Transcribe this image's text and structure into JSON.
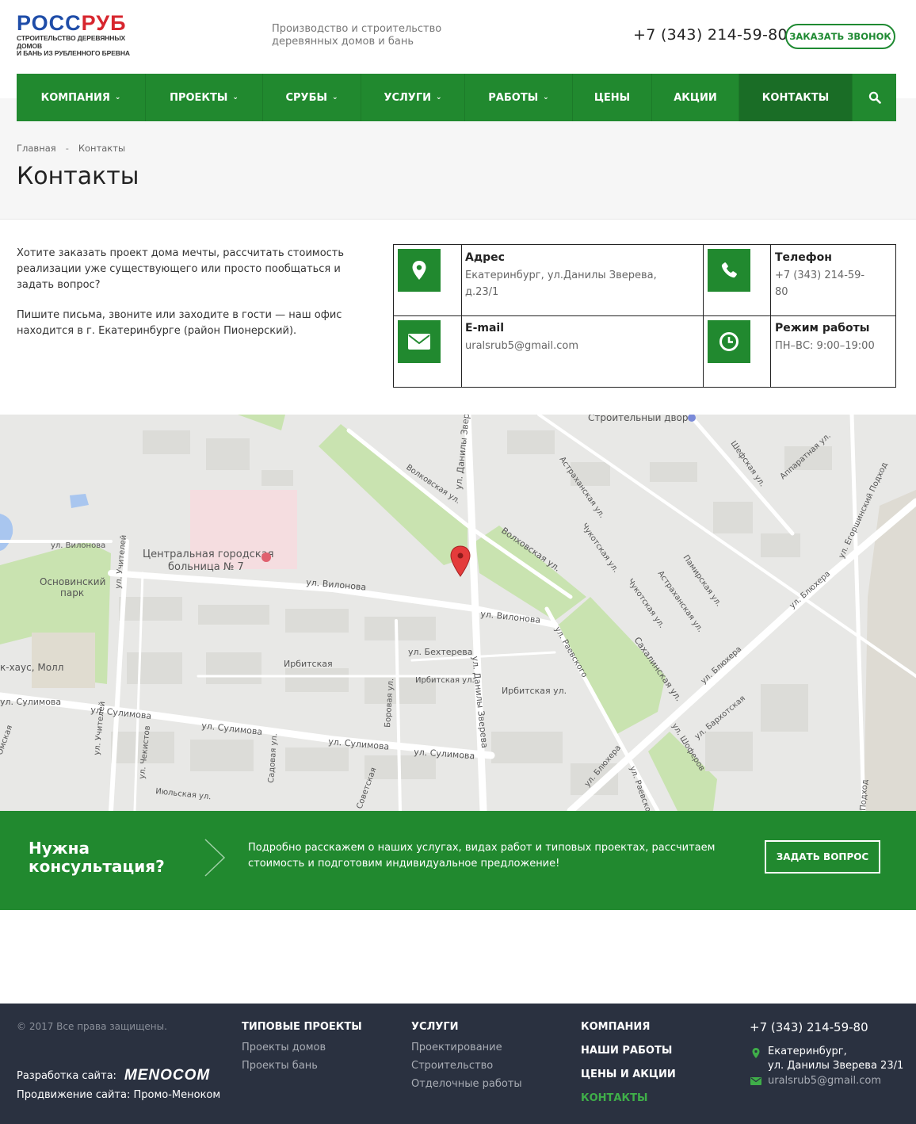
{
  "header": {
    "logo_title": "РОССРУБ",
    "logo_line1": "СТРОИТЕЛЬСТВО ДЕРЕВЯННЫХ ДОМОВ",
    "logo_line2": "И БАНЬ ИЗ РУБЛЕННОГО БРЕВНА",
    "tagline_1": "Производство и строительство",
    "tagline_2": "деревянных домов и бань",
    "phone": "+7 (343) 214-59-80",
    "callback_label": "ЗАКАЗАТЬ ЗВОНОК"
  },
  "nav": {
    "items": [
      {
        "label": "КОМПАНИЯ",
        "dropdown": true
      },
      {
        "label": "ПРОЕКТЫ",
        "dropdown": true
      },
      {
        "label": "СРУБЫ",
        "dropdown": true
      },
      {
        "label": "УСЛУГИ",
        "dropdown": true
      },
      {
        "label": "РАБОТЫ",
        "dropdown": true
      },
      {
        "label": "ЦЕНЫ",
        "dropdown": false
      },
      {
        "label": "АКЦИИ",
        "dropdown": false
      },
      {
        "label": "КОНТАКТЫ",
        "dropdown": false,
        "active": true
      }
    ],
    "search_icon": "search-icon"
  },
  "breadcrumb": {
    "home": "Главная",
    "separator": "-",
    "current": "Контакты"
  },
  "page_title": "Контакты",
  "intro": {
    "p1": "Хотите заказать проект дома мечты, рассчитать стоимость реализации уже существующего или просто пообщаться и задать вопрос?",
    "p2": "Пишите письма, звоните или заходите в гости — наш офис находится в г. Екатеринбурге (район Пионерский)."
  },
  "contacts": {
    "address": {
      "label": "Адрес",
      "value_1": "Екатеринбург, ул.Данилы Зверева,",
      "value_2": "д.23/1",
      "icon": "map-marker-icon"
    },
    "phone": {
      "label": "Телефон",
      "value_1": "+7 (343) 214-59-",
      "value_2": "80",
      "icon": "phone-icon"
    },
    "email": {
      "label": "E-mail",
      "value": "uralsrub5@gmail.com",
      "icon": "envelope-icon"
    },
    "hours": {
      "label": "Режим работы",
      "value": "ПН–ВС: 9:00–19:00",
      "icon": "clock-icon"
    }
  },
  "map": {
    "labels": {
      "builder_yard": "Строительный двор",
      "hospital_1": "Центральная городская",
      "hospital_2": "больница № 7",
      "park_1": "Основинский",
      "park_2": "парк",
      "mall": "к-хаус, Молл",
      "vilonova_1": "ул. Вилонова",
      "vilonova_2": "ул. Вилонова",
      "vilonova_3": "ул. Вилонова",
      "sulimova_1": "ул. Сулимова",
      "sulimova_2": "ул. Сулимова",
      "sulimova_3": "ул. Сулимова",
      "sulimova_4": "ул. Сулимова",
      "sulimova_5": "ул. Сулимова",
      "bekhtereva": "ул. Бехтерева",
      "irbitskaya_1": "Ирбитская",
      "irbitskaya_2": "Ирбитская ул.",
      "irbitskaya_3": "Ирбитская ул.",
      "zvereva_1": "ул. Данилы Зверева",
      "zvereva_2": "ул. Данилы Зверева",
      "volkovskaya": "Волковская ул.",
      "volkhovskaya": "Волховская ул.",
      "astrakhanskaya_1": "Астраханская ул.",
      "astrakhanskaya_2": "Астраханская ул.",
      "chukotskaya_1": "Чукотская ул.",
      "chukotskaya_2": "Чукотская ул.",
      "pamirskaya": "Памирская ул.",
      "sakhalinskaya": "Сахалинская ул.",
      "raevskogo_1": "ул. Раевского",
      "raevskogo_2": "ул. Раевского",
      "blyukhera_1": "ул. Блюхера",
      "blyukhera_2": "ул. Блюхера",
      "blyukhera_3": "ул. Блюхера",
      "shoferov_1": "Шефская ул.",
      "shoferov_2": "ул. Шоферов",
      "barkhotskaya": "ул. Бархотская",
      "egorshinsky": "ул. Егоршинский Подход",
      "apparatnaya": "Аппаратная ул.",
      "uchiteley_1": "ул. Учителей",
      "uchiteley_2": "ул. Учителей",
      "chekistov": "ул. Чекистов",
      "borovaya": "Боровая ул.",
      "sadovaya": "Садовая ул.",
      "iyulskaya": "Июльская ул.",
      "sovetskaya": "Советская",
      "omskaya": "Омская",
      "podkhod": "Подход",
      "vilonova_top": "ул. Вилонова"
    }
  },
  "cta": {
    "title_1": "Нужна",
    "title_2": "консультация?",
    "text": "Подробно расскажем о наших услугах, видах работ и типовых проектах, рассчитаем стоимость и подготовим индивидуальное предложение!",
    "button": "ЗАДАТЬ ВОПРОС"
  },
  "footer": {
    "copyright": "© 2017 Все права защищены.",
    "dev_label": "Разработка сайта:",
    "dev_logo": "MENOCOM",
    "promo": "Продвижение сайта: Промо-Меноком",
    "col1": {
      "heading": "ТИПОВЫЕ ПРОЕКТЫ",
      "links": [
        "Проекты домов",
        "Проекты бань"
      ]
    },
    "col2": {
      "heading": "УСЛУГИ",
      "links": [
        "Проектирование",
        "Строительство",
        "Отделочные работы"
      ]
    },
    "col3": {
      "links": [
        "КОМПАНИЯ",
        "НАШИ РАБОТЫ",
        "ЦЕНЫ И АКЦИИ",
        "КОНТАКТЫ"
      ]
    },
    "phone": "+7 (343) 214-59-80",
    "address_1": "Екатеринбург,",
    "address_2": "ул. Данилы Зверева 23/1",
    "email": "uralsrub5@gmail.com"
  },
  "colors": {
    "brand_green": "#21892f",
    "active_nav": "#1a6d26",
    "footer_bg": "#2a3140",
    "footer_active": "#3fae49"
  }
}
